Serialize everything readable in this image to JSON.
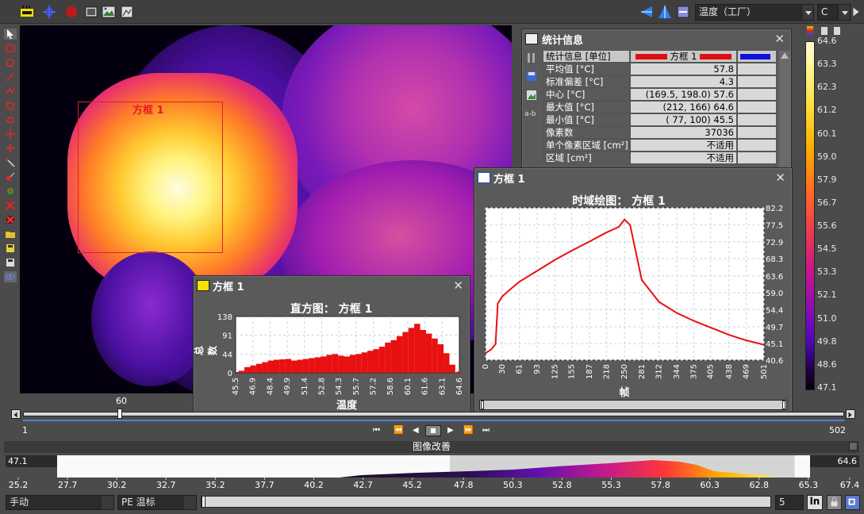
{
  "toolbar": {
    "palette_select": "温度（工厂）",
    "unit_select": "C"
  },
  "image": {
    "roi_label": "方框 1"
  },
  "stats": {
    "title": "统计信息",
    "header": [
      "统计信息 [单位]",
      "方框 1"
    ],
    "rows": [
      {
        "label": "平均值 [°C]",
        "value": "57.8"
      },
      {
        "label": "标准偏差 [°C]",
        "value": "4.3"
      },
      {
        "label": "中心 [°C]",
        "value": "(169.5, 198.0) 57.6"
      },
      {
        "label": "最大值 [°C]",
        "value": "(212, 166) 64.6"
      },
      {
        "label": "最小值 [°C]",
        "value": "( 77, 100) 45.5"
      },
      {
        "label": "像素数",
        "value": "37036"
      },
      {
        "label": "单个像素区域 [cm²]",
        "value": "不适用"
      },
      {
        "label": "区域 [cm²]",
        "value": "不适用"
      }
    ],
    "side_label": "a-b"
  },
  "histogram_panel": {
    "window_title": "方框 1",
    "title": "直方图： 方框 1",
    "ylabel": "总数",
    "xlabel": "温度"
  },
  "time_panel": {
    "window_title": "方框 1",
    "title": "时域绘图： 方框 1",
    "xlabel": "帧"
  },
  "chart_data": [
    {
      "type": "bar",
      "title": "直方图： 方框 1",
      "xlabel": "温度",
      "ylabel": "总数",
      "xlim": [
        45.5,
        64.6
      ],
      "ylim": [
        0,
        138
      ],
      "y_ticks": [
        "138",
        "91",
        "44",
        "0"
      ],
      "x_ticks": [
        "45.5",
        "46.9",
        "48.4",
        "49.9",
        "51.4",
        "52.8",
        "54.3",
        "55.7",
        "57.2",
        "58.6",
        "60.1",
        "61.6",
        "63.1",
        "64.6"
      ],
      "x": [
        45.5,
        46.0,
        46.5,
        47.0,
        47.5,
        48.0,
        48.5,
        49.0,
        49.5,
        50.0,
        50.5,
        51.0,
        51.5,
        52.0,
        52.5,
        53.0,
        53.5,
        54.0,
        54.5,
        55.0,
        55.5,
        56.0,
        56.5,
        57.0,
        57.5,
        58.0,
        58.5,
        59.0,
        59.5,
        60.0,
        60.5,
        61.0,
        61.5,
        62.0,
        62.5,
        63.0,
        63.5,
        64.0,
        64.6
      ],
      "values": [
        2,
        5,
        14,
        18,
        22,
        26,
        30,
        32,
        33,
        34,
        30,
        32,
        34,
        36,
        38,
        40,
        44,
        46,
        42,
        40,
        44,
        46,
        50,
        54,
        58,
        64,
        74,
        80,
        90,
        100,
        110,
        120,
        105,
        96,
        84,
        70,
        48,
        20,
        3
      ]
    },
    {
      "type": "line",
      "title": "时域绘图： 方框 1",
      "xlabel": "帧",
      "ylim": [
        40.6,
        82.2
      ],
      "y_ticks": [
        "82.2",
        "77.5",
        "72.9",
        "68.3",
        "63.6",
        "59.0",
        "54.4",
        "49.7",
        "45.1",
        "40.6"
      ],
      "x_ticks": [
        "0",
        "30",
        "61",
        "93",
        "125",
        "155",
        "187",
        "218",
        "250",
        "281",
        "312",
        "344",
        "375",
        "405",
        "438",
        "469",
        "501"
      ],
      "x": [
        0,
        10,
        18,
        22,
        30,
        45,
        61,
        93,
        125,
        155,
        187,
        218,
        240,
        250,
        260,
        281,
        312,
        344,
        375,
        405,
        438,
        469,
        501
      ],
      "values": [
        42.5,
        43.5,
        45,
        56,
        58,
        60,
        62,
        65,
        68,
        70.5,
        73,
        75.5,
        77,
        79,
        77.5,
        62.5,
        56.5,
        53.5,
        51.3,
        49.5,
        47.5,
        46,
        44.8
      ]
    },
    {
      "type": "area",
      "title": "",
      "x_ticks": [
        "25.2",
        "27.7",
        "30.2",
        "32.7",
        "35.2",
        "37.7",
        "40.2",
        "42.7",
        "45.2",
        "47.8",
        "50.3",
        "52.8",
        "55.3",
        "57.8",
        "60.3",
        "62.8",
        "65.3",
        "67.4"
      ],
      "range_low": "47.1",
      "range_high": "64.6"
    }
  ],
  "color_scale": {
    "labels": [
      "64.6",
      "63.3",
      "62.3",
      "61.2",
      "60.1",
      "59.0",
      "57.9",
      "56.7",
      "55.6",
      "54.5",
      "53.3",
      "52.1",
      "51.0",
      "49.8",
      "48.6",
      "47.1"
    ]
  },
  "timeline": {
    "marker": "60",
    "start": "1",
    "end": "502"
  },
  "enhancement": {
    "title": "图像改善",
    "mode": "手动",
    "palette": "PE 温标",
    "step": "5",
    "ln_label": "ln"
  }
}
